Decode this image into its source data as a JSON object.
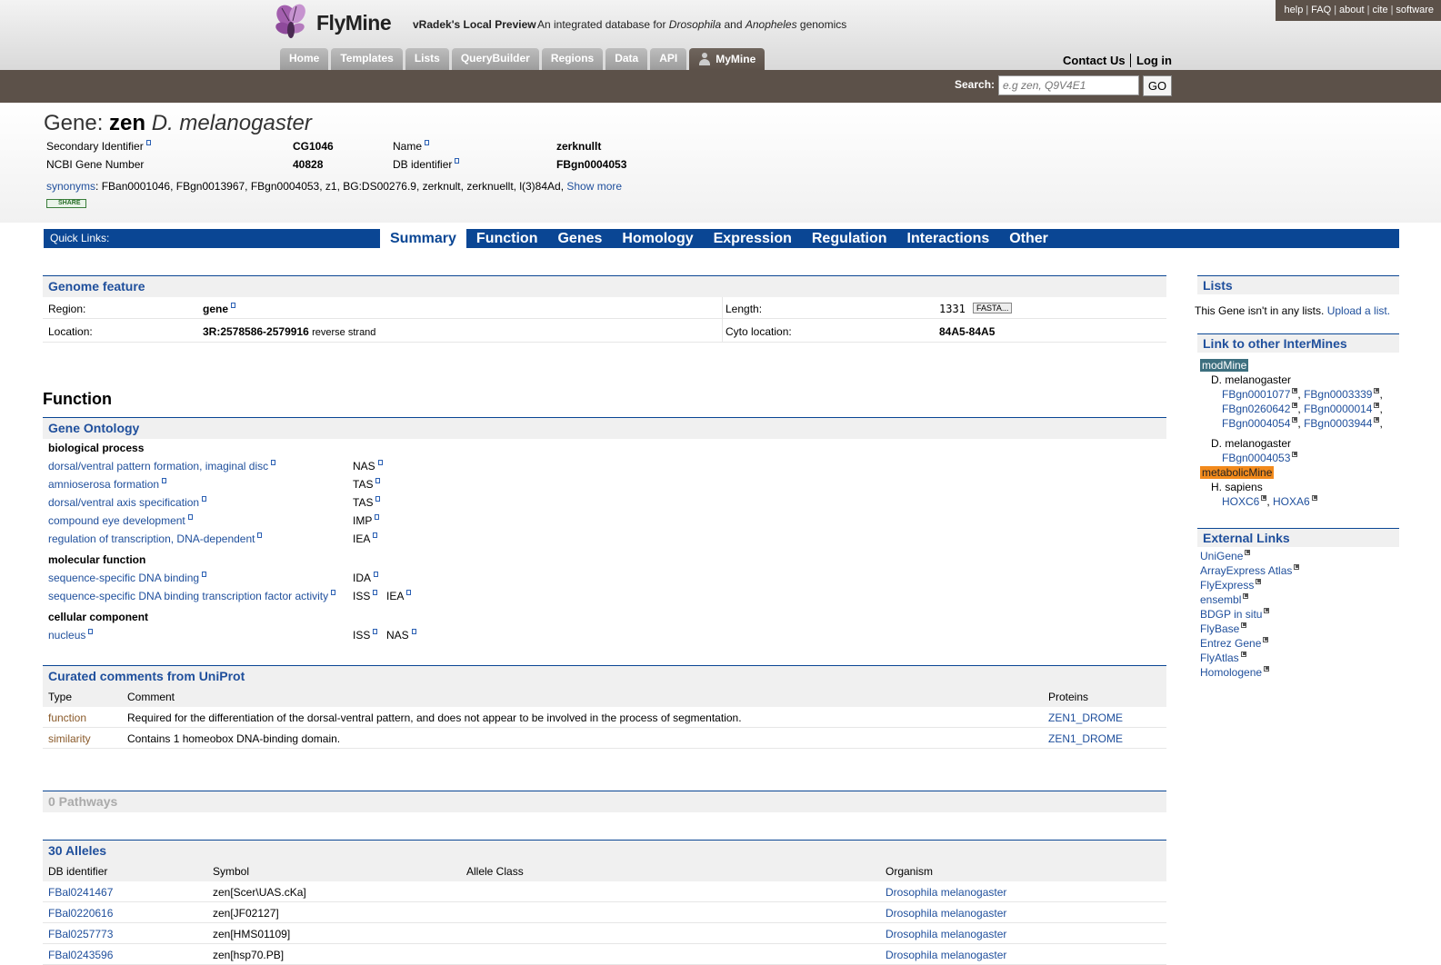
{
  "topnav": [
    "help",
    "FAQ",
    "about",
    "cite",
    "software"
  ],
  "brand": "FlyMine",
  "release": "vRadek's Local Preview",
  "tagline_parts": [
    "An integrated database for ",
    "Drosophila",
    " and ",
    "Anopheles",
    " genomics"
  ],
  "tabs": [
    "Home",
    "Templates",
    "Lists",
    "QueryBuilder",
    "Regions",
    "Data",
    "API",
    "MyMine"
  ],
  "contact": "Contact Us",
  "login": "Log in",
  "search": {
    "label": "Search:",
    "placeholder": "e.g zen, Q9V4E1",
    "button": "GO"
  },
  "gene": {
    "prefix": "Gene: ",
    "symbol": "zen",
    "organism": "D. melanogaster",
    "fields": [
      {
        "label": "Secondary Identifier",
        "value": "CG1046"
      },
      {
        "label": "Name",
        "value": "zerknullt"
      },
      {
        "label": "NCBI Gene Number",
        "value": "40828"
      },
      {
        "label": "DB identifier",
        "value": "FBgn0004053"
      }
    ],
    "synonyms_label": "synonyms",
    "synonyms": ": FBan0001046, FBgn0013967, FBgn0004053, z1, BG:DS00276.9, zerknult, zerknuellt, l(3)84Ad,",
    "show_more": "Show more",
    "share": "SHARE"
  },
  "quicklinks": {
    "label": "Quick Links:",
    "items": [
      "Summary",
      "Function",
      "Genes",
      "Homology",
      "Expression",
      "Regulation",
      "Interactions",
      "Other"
    ]
  },
  "genome_feature": {
    "title": "Genome feature",
    "region_label": "Region:",
    "region_value": "gene",
    "length_label": "Length:",
    "length_value": "1331",
    "fasta": "FASTA...",
    "location_label": "Location:",
    "location_value": "3R:2578586-2579916",
    "strand": "reverse strand",
    "cyto_label": "Cyto location:",
    "cyto_value": "84A5-84A5"
  },
  "function_heading": "Function",
  "go": {
    "title": "Gene Ontology",
    "groups": [
      {
        "name": "biological process",
        "terms": [
          {
            "term": "dorsal/ventral pattern formation, imaginal disc",
            "codes": [
              "NAS"
            ]
          },
          {
            "term": "amnioserosa formation",
            "codes": [
              "TAS"
            ]
          },
          {
            "term": "dorsal/ventral axis specification",
            "codes": [
              "TAS"
            ]
          },
          {
            "term": "compound eye development",
            "codes": [
              "IMP"
            ]
          },
          {
            "term": "regulation of transcription, DNA-dependent",
            "codes": [
              "IEA"
            ]
          }
        ]
      },
      {
        "name": "molecular function",
        "terms": [
          {
            "term": "sequence-specific DNA binding",
            "codes": [
              "IDA"
            ]
          },
          {
            "term": "sequence-specific DNA binding transcription factor activity",
            "codes": [
              "ISS",
              "IEA"
            ]
          }
        ]
      },
      {
        "name": "cellular component",
        "terms": [
          {
            "term": "nucleus",
            "codes": [
              "ISS",
              "NAS"
            ]
          }
        ]
      }
    ]
  },
  "comments": {
    "title": "Curated comments from UniProt",
    "headers": [
      "Type",
      "Comment",
      "Proteins"
    ],
    "rows": [
      {
        "type": "function",
        "comment": "Required for the differentiation of the dorsal-ventral pattern, and does not appear to be involved in the process of segmentation.",
        "protein": "ZEN1_DROME"
      },
      {
        "type": "similarity",
        "comment": "Contains 1 homeobox DNA-binding domain.",
        "protein": "ZEN1_DROME"
      }
    ]
  },
  "pathways": {
    "title": "0 Pathways"
  },
  "alleles": {
    "title": "30 Alleles",
    "headers": [
      "DB identifier",
      "Symbol",
      "Allele Class",
      "Organism"
    ],
    "rows": [
      {
        "id": "FBal0241467",
        "symbol": "zen[Scer\\UAS.cKa]",
        "class": "",
        "organism": "Drosophila melanogaster"
      },
      {
        "id": "FBal0220616",
        "symbol": "zen[JF02127]",
        "class": "",
        "organism": "Drosophila melanogaster"
      },
      {
        "id": "FBal0257773",
        "symbol": "zen[HMS01109]",
        "class": "",
        "organism": "Drosophila melanogaster"
      },
      {
        "id": "FBal0243596",
        "symbol": "zen[hsp70.PB]",
        "class": "",
        "organism": "Drosophila melanogaster"
      }
    ]
  },
  "lists": {
    "title": "Lists",
    "text": "This Gene isn't in any lists. ",
    "link": "Upload a list."
  },
  "intermines": {
    "title": "Link to other InterMines",
    "modmine": "modMine",
    "mod_org1": "D. melanogaster",
    "mod_ids": [
      "FBgn0001077",
      "FBgn0003339",
      "FBgn0260642",
      "FBgn0000014",
      "FBgn0004054",
      "FBgn0003944"
    ],
    "mod_org2": "D. melanogaster",
    "mod_id2": "FBgn0004053",
    "metabolicmine": "metabolicMine",
    "met_org": "H. sapiens",
    "met_ids": [
      "HOXC6",
      "HOXA6"
    ]
  },
  "external": {
    "title": "External Links",
    "links": [
      "UniGene",
      "ArrayExpress Atlas",
      "FlyExpress",
      "ensembl",
      "BDGP in situ",
      "FlyBase",
      "Entrez Gene",
      "FlyAtlas",
      "Homologene"
    ]
  }
}
